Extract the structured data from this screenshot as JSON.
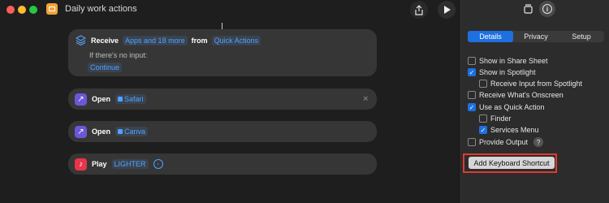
{
  "window": {
    "title": "Daily work actions"
  },
  "toolbar": {
    "share_icon": "share-icon",
    "play_icon": "play-icon",
    "library_icon": "library-icon",
    "info_icon": "info-icon"
  },
  "receive": {
    "verb": "Receive",
    "types": "Apps and 18 more",
    "from_label": "from",
    "source": "Quick Actions",
    "no_input_label": "If there's no input:",
    "no_input_value": "Continue"
  },
  "actions": [
    {
      "verb": "Open",
      "param": "Safari"
    },
    {
      "verb": "Open",
      "param": "Canva"
    },
    {
      "verb": "Play",
      "param": "LIGHTER"
    }
  ],
  "details": {
    "tabs": [
      "Details",
      "Privacy",
      "Setup"
    ],
    "active_tab": "Details",
    "options": [
      {
        "label": "Show in Share Sheet",
        "checked": false
      },
      {
        "label": "Show in Spotlight",
        "checked": true
      },
      {
        "label": "Receive Input from Spotlight",
        "checked": false
      },
      {
        "label": "Receive What's Onscreen",
        "checked": false
      },
      {
        "label": "Use as Quick Action",
        "checked": true
      },
      {
        "label": "Finder",
        "checked": false
      },
      {
        "label": "Services Menu",
        "checked": true
      },
      {
        "label": "Provide Output",
        "checked": false
      }
    ],
    "help_glyph": "?",
    "keyboard_button": "Add Keyboard Shortcut"
  },
  "colors": {
    "accent": "#1e6fe0",
    "highlight": "#e03a2f"
  }
}
